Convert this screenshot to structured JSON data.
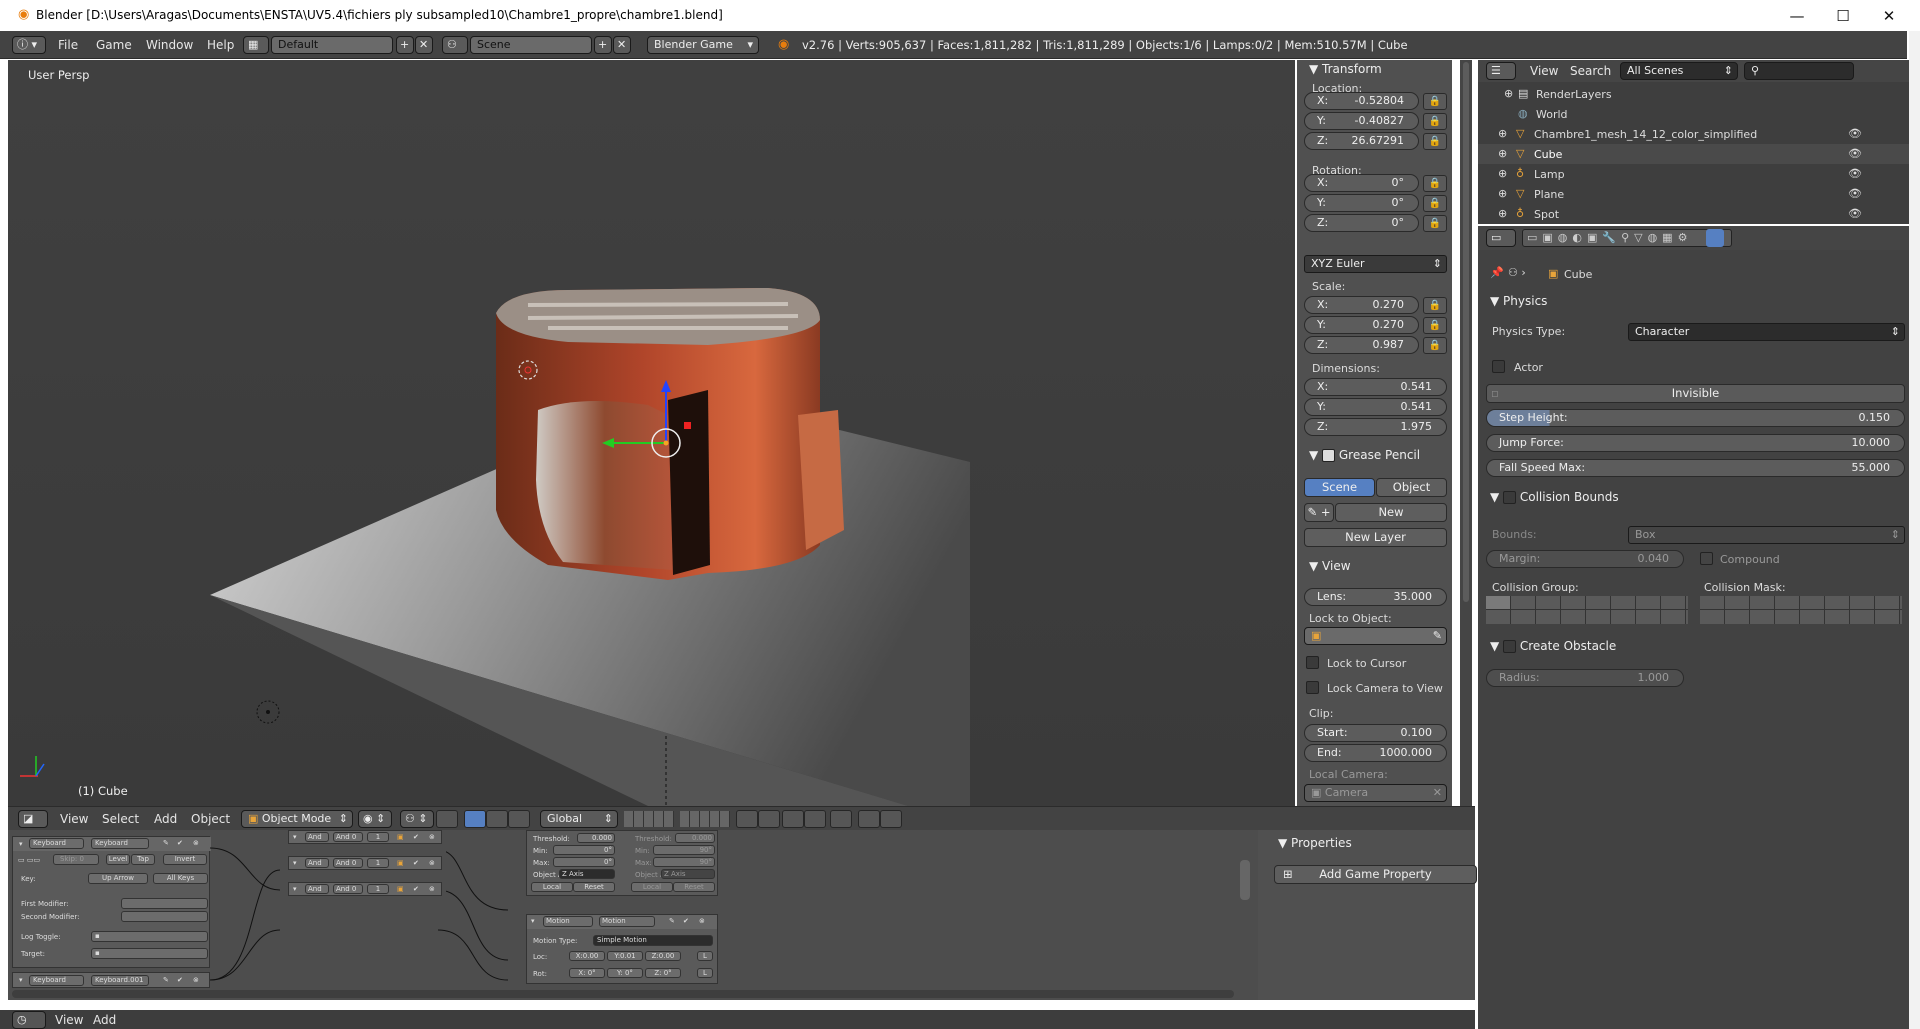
{
  "window": {
    "title": "Blender [D:\\Users\\Aragas\\Documents\\ENSTA\\UV5.4\\fichiers ply subsampled10\\Chambre1_propre\\chambre1.blend]",
    "minimize": "—",
    "maximize": "☐",
    "close": "✕"
  },
  "infobar": {
    "menus": [
      "File",
      "Game",
      "Window",
      "Help"
    ],
    "layout": "Default",
    "scene": "Scene",
    "engine": "Blender Game",
    "stats": "v2.76 | Verts:905,637 | Faces:1,811,282 | Tris:1,811,289 | Objects:1/6 | Lamps:0/2 | Mem:510.57M | Cube"
  },
  "viewport": {
    "view_name": "User Persp",
    "object_label": "(1) Cube"
  },
  "transform": {
    "title": "Transform",
    "location_label": "Location:",
    "location": [
      {
        "k": "X:",
        "v": "-0.52804"
      },
      {
        "k": "Y:",
        "v": "-0.40827"
      },
      {
        "k": "Z:",
        "v": "26.67291"
      }
    ],
    "rotation_label": "Rotation:",
    "rotation": [
      {
        "k": "X:",
        "v": "0°"
      },
      {
        "k": "Y:",
        "v": "0°"
      },
      {
        "k": "Z:",
        "v": "0°"
      }
    ],
    "rotation_mode": "XYZ Euler",
    "scale_label": "Scale:",
    "scale": [
      {
        "k": "X:",
        "v": "0.270"
      },
      {
        "k": "Y:",
        "v": "0.270"
      },
      {
        "k": "Z:",
        "v": "0.987"
      }
    ],
    "dimensions_label": "Dimensions:",
    "dimensions": [
      {
        "k": "X:",
        "v": "0.541"
      },
      {
        "k": "Y:",
        "v": "0.541"
      },
      {
        "k": "Z:",
        "v": "1.975"
      }
    ]
  },
  "grease_pencil": {
    "title": "Grease Pencil",
    "scene": "Scene",
    "object": "Object",
    "new": "New",
    "new_layer": "New Layer"
  },
  "view_panel": {
    "title": "View",
    "lens_k": "Lens:",
    "lens_v": "35.000",
    "lock_to_object": "Lock to Object:",
    "lock_to_cursor": "Lock to Cursor",
    "lock_camera": "Lock Camera to View",
    "clip": "Clip:",
    "start_k": "Start:",
    "start_v": "0.100",
    "end_k": "End:",
    "end_v": "1000.000",
    "local_camera": "Local Camera:",
    "camera": "Camera"
  },
  "outliner": {
    "view": "View",
    "search": "Search",
    "scenes": "All Scenes",
    "items": [
      "RenderLayers",
      "World",
      "Chambre1_mesh_14_12_color_simplified",
      "Cube",
      "Lamp",
      "Plane",
      "Spot"
    ]
  },
  "properties": {
    "object_name": "Cube",
    "physics_title": "Physics",
    "physics_type_label": "Physics Type:",
    "physics_type": "Character",
    "actor": "Actor",
    "invisible": "Invisible",
    "step_height_k": "Step Height:",
    "step_height_v": "0.150",
    "jump_force_k": "Jump Force:",
    "jump_force_v": "10.000",
    "fall_speed_k": "Fall Speed Max:",
    "fall_speed_v": "55.000",
    "collision_bounds": "Collision Bounds",
    "bounds_label": "Bounds:",
    "bounds_value": "Box",
    "margin_k": "Margin:",
    "margin_v": "0.040",
    "compound": "Compound",
    "collision_group": "Collision Group:",
    "collision_mask": "Collision Mask:",
    "create_obstacle": "Create Obstacle",
    "radius_k": "Radius:",
    "radius_v": "1.000"
  },
  "view3d_header": {
    "menus": [
      "View",
      "Select",
      "Add",
      "Object"
    ],
    "mode": "Object Mode",
    "orientation": "Global"
  },
  "logic": {
    "properties_title": "Properties",
    "add_game_property": "Add Game Property",
    "sensor1_type": "Keyboard",
    "sensor1_name": "Keyboard",
    "skip": "Skip: 0",
    "level": "Level",
    "tap": "Tap",
    "invert": "Invert",
    "key_label": "Key:",
    "key_value": "Up Arrow",
    "all_keys": "All Keys",
    "first_mod": "First Modifier:",
    "second_mod": "Second Modifier:",
    "log_toggle": "Log Toggle:",
    "target": "Target:",
    "sensor2_type": "Keyboard",
    "sensor2_name": "Keyboard.001",
    "and": "And",
    "and_name": "And 0",
    "one": "1",
    "threshold": "Threshold:",
    "threshold_v": "0.000",
    "min": "Min:",
    "max": "Max:",
    "deg": "0°",
    "min_r": "90°",
    "object_axis": "Object A",
    "z_axis": "Z Axis",
    "local": "Local",
    "reset": "Reset",
    "motion_type": "Motion",
    "motion_name": "Motion",
    "motion_type_label": "Motion Type:",
    "motion_type_value": "Simple Motion",
    "loc_label": "Loc:",
    "rot_label": "Rot:",
    "loc_vals": [
      "X:0.00",
      "Y:0.01",
      "Z:0.00"
    ],
    "rot_vals": [
      "X: 0°",
      "Y: 0°",
      "Z: 0°"
    ],
    "l": "L"
  },
  "bottom": {
    "view": "View",
    "add": "Add"
  }
}
